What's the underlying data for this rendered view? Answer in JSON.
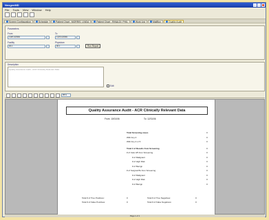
{
  "window": {
    "title": "NexgenMD"
  },
  "menu": [
    "File",
    "Tools",
    "View",
    "Window",
    "Help"
  ],
  "tabs": [
    "Screen Configuration",
    "Schedule",
    "Patient Chart - MORRIS, LINDA",
    "Patient Chart - RINALDI, PHIL",
    "Work List",
    "MailBox",
    "Quality Audit"
  ],
  "params": {
    "heading": "Parameters",
    "from_label": "From",
    "from_value": "10/01/2006",
    "to_label": "To",
    "to_value": "12/31/2006",
    "facility_label": "Facility",
    "facility_value": "ALL",
    "physician_label": "Physician",
    "physician_value": "ALL",
    "run_label": "Run Report"
  },
  "description": {
    "heading": "Description",
    "text": "Quality Assurance Audit - ACR Clinically Relevant Data",
    "checkbox_label": "Edit"
  },
  "viewer": {
    "zoom": "85%"
  },
  "report": {
    "title": "Quality Assurance Audit - ACR Clinically Relevant Data",
    "from": "From: 10/01/06",
    "to": "To: 12/31/06",
    "rows": [
      {
        "label": "Total Screening cases",
        "value": "0",
        "indent": 0,
        "bold": true
      },
      {
        "label": "With Any 0",
        "value": "0",
        "indent": 0,
        "bold": false
      },
      {
        "label": "With Any 4 or 5",
        "value": "0",
        "indent": 0,
        "bold": false
      },
      {
        "label": "Total # of Results from Screening",
        "value": "0",
        "indent": 0,
        "bold": true
      },
      {
        "label": "# of Cats 4/5 from Screening",
        "value": "0",
        "indent": 0,
        "bold": false
      },
      {
        "label": "# of Malignant",
        "value": "0",
        "indent": 1,
        "bold": false
      },
      {
        "label": "# of High Risk",
        "value": "0",
        "indent": 1,
        "bold": false
      },
      {
        "label": "# of Benign",
        "value": "0",
        "indent": 1,
        "bold": false
      },
      {
        "label": "# of Surgical Bx from Screening",
        "value": "0",
        "indent": 0,
        "bold": false
      },
      {
        "label": "# of Malignant",
        "value": "0",
        "indent": 1,
        "bold": false
      },
      {
        "label": "# of High Risk",
        "value": "0",
        "indent": 1,
        "bold": false
      },
      {
        "label": "# of Benign",
        "value": "0",
        "indent": 1,
        "bold": false
      }
    ],
    "totals": [
      {
        "label": "Total # of True Positives:",
        "value": "0"
      },
      {
        "label": "Total # of True Negatives:",
        "value": "0"
      },
      {
        "label": "Total # of False Positives:",
        "value": "0"
      },
      {
        "label": "Total # of False Negatives:",
        "value": "0"
      }
    ],
    "page_status": "Page 1 of 1"
  }
}
